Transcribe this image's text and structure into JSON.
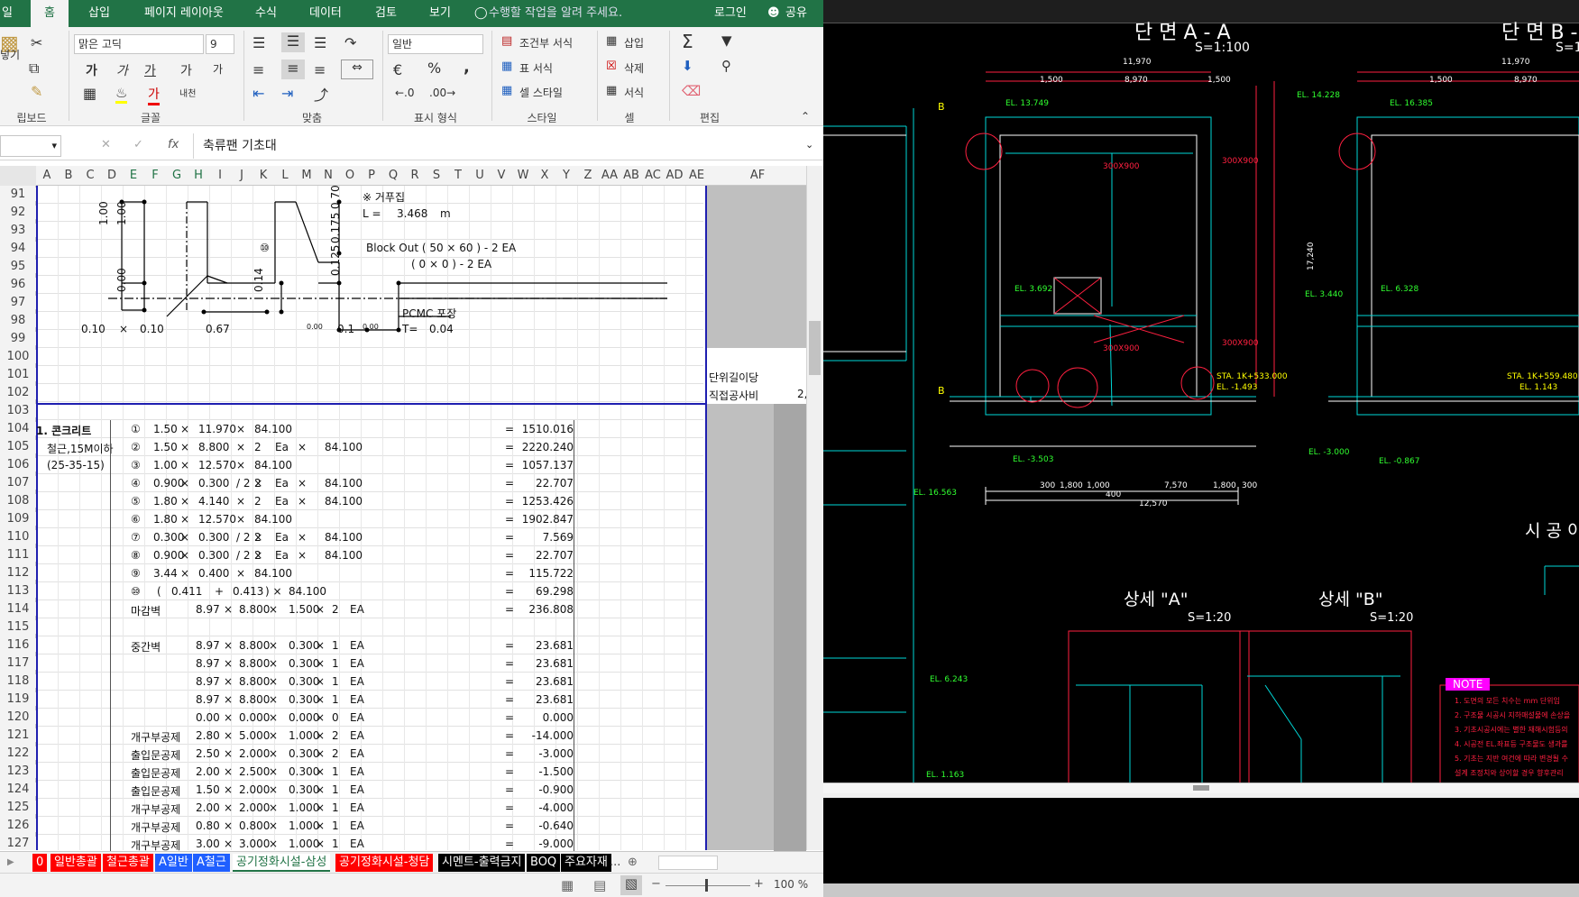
{
  "ribbon_tabs": [
    "일",
    "홈",
    "삽입",
    "페이지 레이아웃",
    "수식",
    "데이터",
    "검토",
    "보기"
  ],
  "tell_me": "수행할 작업을 알려 주세요.",
  "login": "로그인",
  "share": "공유",
  "clipboard": {
    "paste_label": "넣기",
    "group": "립보드"
  },
  "font": {
    "name": "맑은 고딕",
    "size": "9",
    "bold": "가",
    "italic": "가",
    "underline": "가",
    "grow": "가",
    "shrink": "가",
    "phonetic": "내천",
    "group": "글꼴"
  },
  "align": {
    "group": "맞춤"
  },
  "number": {
    "format": "일반",
    "percent": "%",
    "comma": ",",
    "group": "표시 형식"
  },
  "styles": {
    "conditional": "조건부 서식",
    "table": "표 서식",
    "cell": "셀 스타일",
    "group": "스타일"
  },
  "cells": {
    "insert": "삽입",
    "delete": "삭제",
    "format": "서식",
    "group": "셀"
  },
  "editing": {
    "group": "편집"
  },
  "formula_bar": {
    "fx": "fx",
    "value": "축류팬 기초대"
  },
  "columns": [
    "A",
    "B",
    "C",
    "D",
    "E",
    "F",
    "G",
    "H",
    "I",
    "J",
    "K",
    "L",
    "M",
    "N",
    "O",
    "P",
    "Q",
    "R",
    "S",
    "T",
    "U",
    "V",
    "W",
    "X",
    "Y",
    "Z",
    "AA",
    "AB",
    "AC",
    "AD",
    "AE",
    "AF"
  ],
  "rows_top": [
    "91",
    "92",
    "93",
    "94",
    "95",
    "96",
    "97",
    "98",
    "99",
    "100",
    "101",
    "102",
    "103"
  ],
  "rows_bottom": [
    "104",
    "105",
    "106",
    "107",
    "108",
    "109",
    "110",
    "111",
    "112",
    "113",
    "114",
    "115",
    "116",
    "117",
    "118",
    "119",
    "120",
    "121",
    "122",
    "123",
    "124",
    "125",
    "126",
    "127",
    "128"
  ],
  "sketch": {
    "note": "※ 거푸집",
    "l_label": "L =",
    "l_value": "3.468",
    "l_unit": "m",
    "blockout1": "Block Out (   50    ×   60  ) -     2   EA",
    "blockout2": "(    0    ×    0   ) -     2   EA",
    "pcmc": "PCMC 포장",
    "t_label": "T=",
    "t_value": "0.04",
    "dim_bottom": [
      "0.10",
      "×",
      "0.10",
      "0.67",
      "0.00",
      "0.1",
      "0.00"
    ],
    "dim_vert": [
      "1.00",
      "1.00",
      "0.00",
      "0.14",
      "0.70",
      "0.175",
      "0.125"
    ],
    "circle": "⑩"
  },
  "side": {
    "unit_len": "단위길이당",
    "direct_cost": "직접공사비",
    "cut": "2,"
  },
  "calc_rows": [
    {
      "a": "1. 콘크리트",
      "n": "①",
      "v": [
        "1.50",
        "×",
        "11.970",
        "×",
        "84.100"
      ],
      "r": "1510.016"
    },
    {
      "a": "철근,15M이하",
      "n": "②",
      "v": [
        "1.50",
        "×",
        "8.800",
        "×",
        "2",
        "Ea",
        "×",
        "84.100"
      ],
      "r": "2220.240"
    },
    {
      "a": "(25-35-15)",
      "n": "③",
      "v": [
        "1.00",
        "×",
        "12.570",
        "×",
        "84.100"
      ],
      "r": "1057.137"
    },
    {
      "a": "",
      "n": "④",
      "v": [
        "0.900",
        "×",
        "0.300",
        "/ 2 ×",
        "2",
        "Ea",
        "×",
        "84.100"
      ],
      "r": "22.707"
    },
    {
      "a": "",
      "n": "⑤",
      "v": [
        "1.80",
        "×",
        "4.140",
        "×",
        "2",
        "Ea",
        "×",
        "84.100"
      ],
      "r": "1253.426"
    },
    {
      "a": "",
      "n": "⑥",
      "v": [
        "1.80",
        "×",
        "12.570",
        "×",
        "84.100"
      ],
      "r": "1902.847"
    },
    {
      "a": "",
      "n": "⑦",
      "v": [
        "0.300",
        "×",
        "0.300",
        "/ 2 ×",
        "2",
        "Ea",
        "×",
        "84.100"
      ],
      "r": "7.569"
    },
    {
      "a": "",
      "n": "⑧",
      "v": [
        "0.900",
        "×",
        "0.300",
        "/ 2 ×",
        "2",
        "Ea",
        "×",
        "84.100"
      ],
      "r": "22.707"
    },
    {
      "a": "",
      "n": "⑨",
      "v": [
        "3.44",
        "×",
        "0.400",
        "×",
        "84.100"
      ],
      "r": "115.722"
    },
    {
      "a": "",
      "n": "⑩",
      "v": [
        "(",
        "0.411",
        "+",
        "0.413",
        ") ×",
        "84.100"
      ],
      "r": "69.298"
    },
    {
      "a": "",
      "n": "마감벽",
      "v": [
        "8.97",
        "×",
        "8.800",
        "×",
        "1.500",
        "×",
        "2",
        "EA"
      ],
      "r": "236.808"
    },
    {
      "a": "",
      "n": "",
      "v": [],
      "r": ""
    },
    {
      "a": "",
      "n": "중간벽",
      "v": [
        "8.97",
        "×",
        "8.800",
        "×",
        "0.300",
        "×",
        "1",
        "EA"
      ],
      "r": "23.681"
    },
    {
      "a": "",
      "n": "",
      "v": [
        "8.97",
        "×",
        "8.800",
        "×",
        "0.300",
        "×",
        "1",
        "EA"
      ],
      "r": "23.681"
    },
    {
      "a": "",
      "n": "",
      "v": [
        "8.97",
        "×",
        "8.800",
        "×",
        "0.300",
        "×",
        "1",
        "EA"
      ],
      "r": "23.681"
    },
    {
      "a": "",
      "n": "",
      "v": [
        "8.97",
        "×",
        "8.800",
        "×",
        "0.300",
        "×",
        "1",
        "EA"
      ],
      "r": "23.681"
    },
    {
      "a": "",
      "n": "",
      "v": [
        "0.00",
        "×",
        "0.000",
        "×",
        "0.000",
        "×",
        "0",
        "EA"
      ],
      "r": "0.000"
    },
    {
      "a": "",
      "n": "개구부공제",
      "v": [
        "2.80",
        "×",
        "5.000",
        "×",
        "1.000",
        "×",
        "2",
        "EA"
      ],
      "r": "-14.000"
    },
    {
      "a": "",
      "n": "출입문공제",
      "v": [
        "2.50",
        "×",
        "2.000",
        "×",
        "0.300",
        "×",
        "2",
        "EA"
      ],
      "r": "-3.000"
    },
    {
      "a": "",
      "n": "출입문공제",
      "v": [
        "2.00",
        "×",
        "2.500",
        "×",
        "0.300",
        "×",
        "1",
        "EA"
      ],
      "r": "-1.500"
    },
    {
      "a": "",
      "n": "출입문공제",
      "v": [
        "1.50",
        "×",
        "2.000",
        "×",
        "0.300",
        "×",
        "1",
        "EA"
      ],
      "r": "-0.900"
    },
    {
      "a": "",
      "n": "개구부공제",
      "v": [
        "2.00",
        "×",
        "2.000",
        "×",
        "1.000",
        "×",
        "1",
        "EA"
      ],
      "r": "-4.000"
    },
    {
      "a": "",
      "n": "개구부공제",
      "v": [
        "0.80",
        "×",
        "0.800",
        "×",
        "1.000",
        "×",
        "1",
        "EA"
      ],
      "r": "-0.640"
    },
    {
      "a": "",
      "n": "개구부공제",
      "v": [
        "3.00",
        "×",
        "3.000",
        "×",
        "1.000",
        "×",
        "1",
        "EA"
      ],
      "r": "-9.000"
    }
  ],
  "eq": "=",
  "sheet_tabs": [
    {
      "label": "0",
      "bg": "#ff0000",
      "fg": "#ffffff"
    },
    {
      "label": "일반총괄",
      "bg": "#ff0000",
      "fg": "#ffffff"
    },
    {
      "label": "철근총괄",
      "bg": "#ff0000",
      "fg": "#ffffff"
    },
    {
      "label": "A일반",
      "bg": "#1f5fff",
      "fg": "#ffffff"
    },
    {
      "label": "A철근",
      "bg": "#1f5fff",
      "fg": "#ffffff"
    },
    {
      "label": "공기정화시설-삼성",
      "bg": "#ffffff",
      "fg": "#217346"
    },
    {
      "label": "공기정화시설-청담",
      "bg": "#ff0000",
      "fg": "#ffffff"
    },
    {
      "label": "시멘트-출력금지",
      "bg": "#000000",
      "fg": "#ffffff"
    },
    {
      "label": "BOQ",
      "bg": "#000000",
      "fg": "#ffffff"
    },
    {
      "label": "주요자재",
      "bg": "#000000",
      "fg": "#ffffff"
    }
  ],
  "sheet_more": "...",
  "zoom": "100 %",
  "cad": {
    "title_a": "단 면 A - A",
    "scale_a": "S=1:100",
    "title_b": "단 면 B -",
    "scale_b": "S=1",
    "detail_a": "상세 \"A\"",
    "detail_a_scale": "S=1:20",
    "detail_b": "상세 \"B\"",
    "detail_b_scale": "S=1:20",
    "side_title": "시 공 이",
    "note": "NOTE",
    "dims_top": [
      "11,970",
      "1,500",
      "8,970",
      "1,500"
    ],
    "dims_top_b": [
      "11,970",
      "1,500",
      "8,970"
    ],
    "el_labels": [
      "EL. 13.749",
      "EL. 14.228",
      "EL. 16.385",
      "EL. 3.692",
      "EL. 3.440",
      "EL. 6.328",
      "EL. -3.503",
      "EL. -3.000",
      "EL. -0.867",
      "EL. 16.563",
      "EL. 6.243",
      "EL. 1.163"
    ],
    "sta_a": "STA. 1K+533.000",
    "sta_b": "STA. 1K+559.480",
    "el_a": "EL. -1.493",
    "el_b": "EL. 1.143",
    "bottom_dims": [
      "300",
      "1,800",
      "1,000",
      "7,570",
      "1,800",
      "300",
      "12,570",
      "400"
    ],
    "openings": [
      "300X900",
      "300X900",
      "300X900",
      "300X900"
    ],
    "right_vertical": "17,240",
    "notes": [
      "1. 도면의 모든 치수는 mm 단위임",
      "2. 구조물 시공시 지하매설물에 손상을",
      "3. 기초시공시에는 별한 재해시험등의",
      "4. 시공전 EL.좌표등 구조물도 생과를",
      "5. 기초는 지반 여건에 따라 변경될 수",
      "   설계 조정치와 상이할 경우 향후관리",
      "6. 되메우기시 사전의 천정에서 구조물"
    ]
  },
  "b_marker": "B"
}
